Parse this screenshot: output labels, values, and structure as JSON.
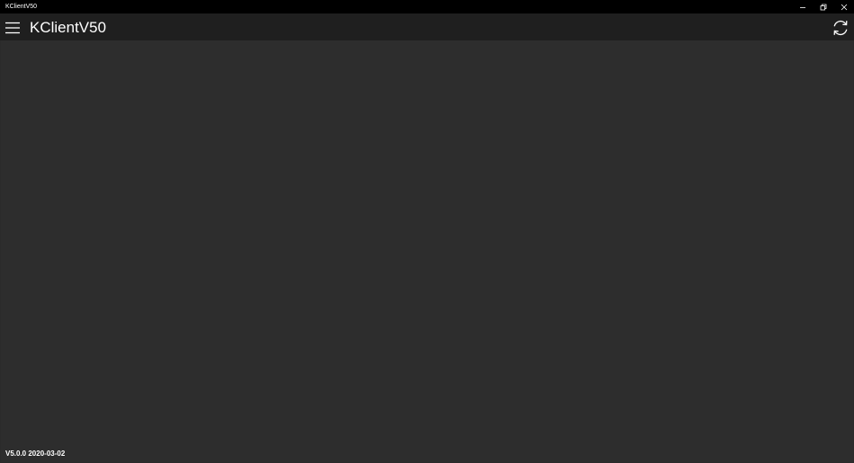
{
  "window": {
    "title": "KClientV50"
  },
  "appbar": {
    "title": "KClientV50",
    "menu_icon": "hamburger-menu-icon",
    "refresh_icon": "refresh-icon"
  },
  "footer": {
    "version": "V5.0.0 2020-03-02"
  },
  "colors": {
    "titlebar_bg": "#000000",
    "appbar_bg": "#1f1f1f",
    "content_bg": "#2d2d2d",
    "text": "#ffffff"
  }
}
